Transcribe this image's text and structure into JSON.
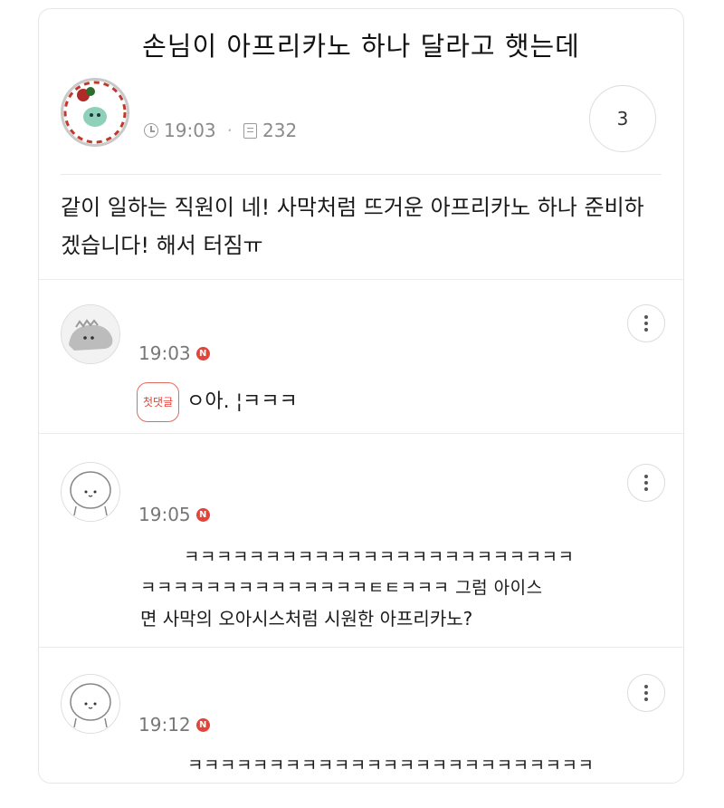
{
  "post": {
    "title": "손님이 아프리카노 하나 달라고 햇는데",
    "time": "19:03",
    "views": "232",
    "comment_count": "3",
    "body": "같이 일하는 직원이 네! 사막처럼 뜨거운 아프리카노 하나 준비하겠습니다! 해서 터짐ㅠ"
  },
  "comments": [
    {
      "time": "19:03",
      "badge": "N",
      "first_label": "첫댓글",
      "text": "ㅇ아.   ¦ㅋㅋㅋ"
    },
    {
      "time": "19:05",
      "badge": "N",
      "text_lines": [
        "ㅋㅋㅋㅋㅋㅋㅋㅋㅋㅋㅋㅋㅋㅋㅋㅋㅋㅋㅋㅋㅋㅋㅋㅋ",
        "ㅋㅋㅋㅋㅋㅋㅋㅋㅋㅋㅋㅋㅋㅋㅌㅌㅋㅋㅋ 그럼 아이스",
        "면 사막의 오아시스처럼 시원한 아프리카노?"
      ]
    },
    {
      "time": "19:12",
      "badge": "N",
      "text": "ㅋㅋㅋㅋㅋㅋㅋㅋㅋㅋㅋㅋㅋㅋㅋㅋㅋㅋㅋㅋㅋㅋㅋㅋㅋ"
    }
  ]
}
